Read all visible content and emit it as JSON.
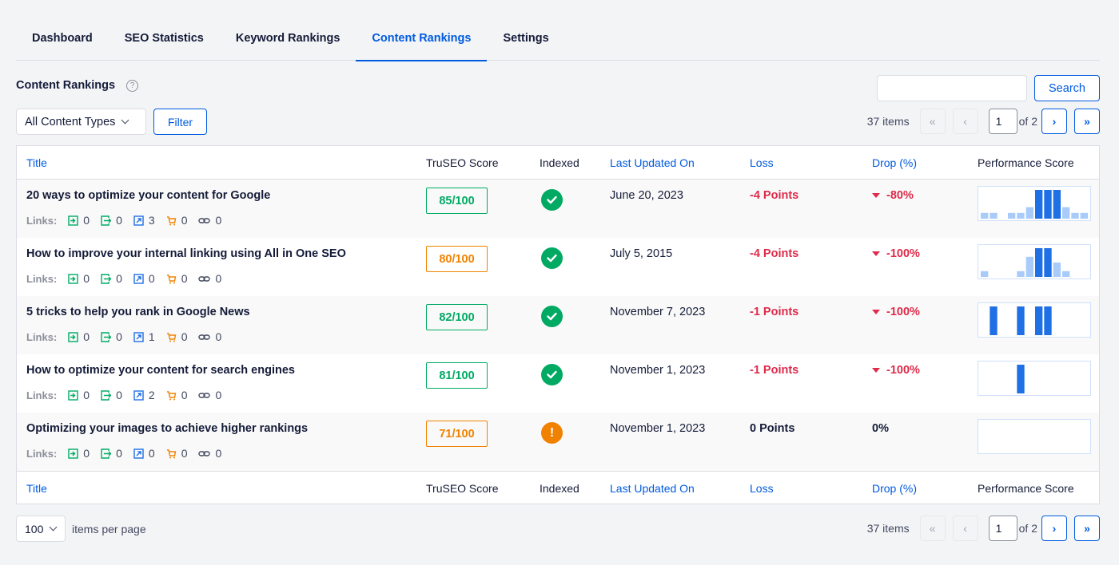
{
  "tabs": [
    {
      "label": "Dashboard",
      "active": false
    },
    {
      "label": "SEO Statistics",
      "active": false
    },
    {
      "label": "Keyword Rankings",
      "active": false
    },
    {
      "label": "Content Rankings",
      "active": true
    },
    {
      "label": "Settings",
      "active": false
    }
  ],
  "section": {
    "title": "Content Rankings",
    "help_icon": "question-circle-icon"
  },
  "search": {
    "value": "",
    "placeholder": "",
    "button_label": "Search"
  },
  "filter": {
    "content_type_selected": "All Content Types",
    "button_label": "Filter"
  },
  "pagination": {
    "items_label": "37 items",
    "current_page": "1",
    "of_label": "of 2",
    "first_icon": "«",
    "prev_icon": "‹",
    "next_icon": "›",
    "last_icon": "»"
  },
  "columns": {
    "title": "Title",
    "score": "TruSEO Score",
    "indexed": "Indexed",
    "updated": "Last Updated On",
    "loss": "Loss",
    "drop": "Drop (%)",
    "performance": "Performance Score"
  },
  "links_label": "Links:",
  "colors": {
    "accent": "#005ae0",
    "good": "#00aa63",
    "warning": "#f18200",
    "negative": "#df2a4a",
    "spark_dark": "#1f6fe5",
    "spark_light": "#a8cbfa"
  },
  "rows": [
    {
      "title": "20 ways to optimize your content for Google",
      "links": {
        "internal_in": "0",
        "internal_out": "0",
        "external": "3",
        "affiliate": "0",
        "other": "0"
      },
      "score": "85/100",
      "score_level": "good",
      "indexed": "yes",
      "updated": "June 20, 2023",
      "loss": "-4 Points",
      "loss_type": "neg",
      "drop": "-80%",
      "drop_type": "neg",
      "performance": [
        2,
        2,
        0,
        2,
        2,
        4,
        10,
        10,
        10,
        4,
        2,
        2
      ],
      "performance_highlight": [
        false,
        false,
        false,
        false,
        false,
        false,
        true,
        true,
        true,
        false,
        false,
        false
      ]
    },
    {
      "title": "How to improve your internal linking using All in One SEO",
      "links": {
        "internal_in": "0",
        "internal_out": "0",
        "external": "0",
        "affiliate": "0",
        "other": "0"
      },
      "score": "80/100",
      "score_level": "ok",
      "indexed": "yes",
      "updated": "July 5, 2015",
      "loss": "-4 Points",
      "loss_type": "neg",
      "drop": "-100%",
      "drop_type": "neg",
      "performance": [
        2,
        0,
        0,
        0,
        2,
        7,
        10,
        10,
        5,
        2,
        0,
        0
      ],
      "performance_highlight": [
        false,
        false,
        false,
        false,
        false,
        false,
        true,
        true,
        false,
        false,
        false,
        false
      ]
    },
    {
      "title": "5 tricks to help you rank in Google News",
      "links": {
        "internal_in": "0",
        "internal_out": "0",
        "external": "1",
        "affiliate": "0",
        "other": "0"
      },
      "score": "82/100",
      "score_level": "good",
      "indexed": "yes",
      "updated": "November 7, 2023",
      "loss": "-1 Points",
      "loss_type": "neg",
      "drop": "-100%",
      "drop_type": "neg",
      "performance": [
        0,
        10,
        0,
        0,
        10,
        0,
        10,
        10,
        0,
        0,
        0,
        0
      ],
      "performance_highlight": [
        false,
        true,
        false,
        false,
        true,
        false,
        true,
        true,
        false,
        false,
        false,
        false
      ]
    },
    {
      "title": "How to optimize your content for search engines",
      "links": {
        "internal_in": "0",
        "internal_out": "0",
        "external": "2",
        "affiliate": "0",
        "other": "0"
      },
      "score": "81/100",
      "score_level": "good",
      "indexed": "yes",
      "updated": "November 1, 2023",
      "loss": "-1 Points",
      "loss_type": "neg",
      "drop": "-100%",
      "drop_type": "neg",
      "performance": [
        0,
        0,
        0,
        0,
        10,
        0,
        0,
        0,
        0,
        0,
        0,
        0
      ],
      "performance_highlight": [
        false,
        false,
        false,
        false,
        true,
        false,
        false,
        false,
        false,
        false,
        false,
        false
      ]
    },
    {
      "title": "Optimizing your images to achieve higher rankings",
      "links": {
        "internal_in": "0",
        "internal_out": "0",
        "external": "0",
        "affiliate": "0",
        "other": "0"
      },
      "score": "71/100",
      "score_level": "ok",
      "indexed": "warning",
      "updated": "November 1, 2023",
      "loss": "0 Points",
      "loss_type": "zero",
      "drop": "0%",
      "drop_type": "zero",
      "performance": [
        0,
        0,
        0,
        0,
        0,
        0,
        0,
        0,
        0,
        0,
        0,
        0
      ],
      "performance_highlight": [
        false,
        false,
        false,
        false,
        false,
        false,
        false,
        false,
        false,
        false,
        false,
        false
      ]
    }
  ],
  "per_page": {
    "selected": "100",
    "label": "items per page"
  }
}
